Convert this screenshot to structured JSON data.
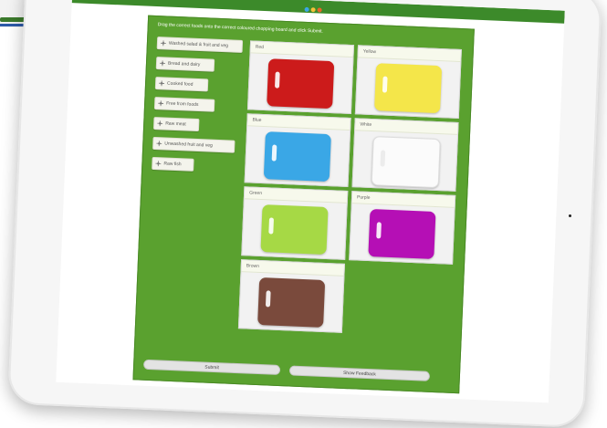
{
  "instruction": "Drag the correct foods onto the correct coloured chopping board and click Submit.",
  "food_items": [
    {
      "label": "Washed salad & fruit and veg"
    },
    {
      "label": "Bread and dairy"
    },
    {
      "label": "Cooked food"
    },
    {
      "label": "Free from foods"
    },
    {
      "label": "Raw meat"
    },
    {
      "label": "Unwashed fruit and veg"
    },
    {
      "label": "Raw fish"
    }
  ],
  "boards": [
    {
      "label": "Red",
      "color": "#cc1b1b"
    },
    {
      "label": "Yellow",
      "color": "#f4e64a"
    },
    {
      "label": "Blue",
      "color": "#3aa7e6"
    },
    {
      "label": "White",
      "color": "#fbfbfb"
    },
    {
      "label": "Green",
      "color": "#a6d945"
    },
    {
      "label": "Purple",
      "color": "#b50fb5"
    },
    {
      "label": "Brown",
      "color": "#7a4a3c"
    }
  ],
  "buttons": {
    "submit_label": "Submit",
    "feedback_label": "Show Feedback"
  },
  "colors": {
    "panel_green": "#5aa12f",
    "topbar_green": "#3c8a2a",
    "topbar_dots": [
      "#3aa7e6",
      "#f4c23a",
      "#e8652a"
    ]
  }
}
